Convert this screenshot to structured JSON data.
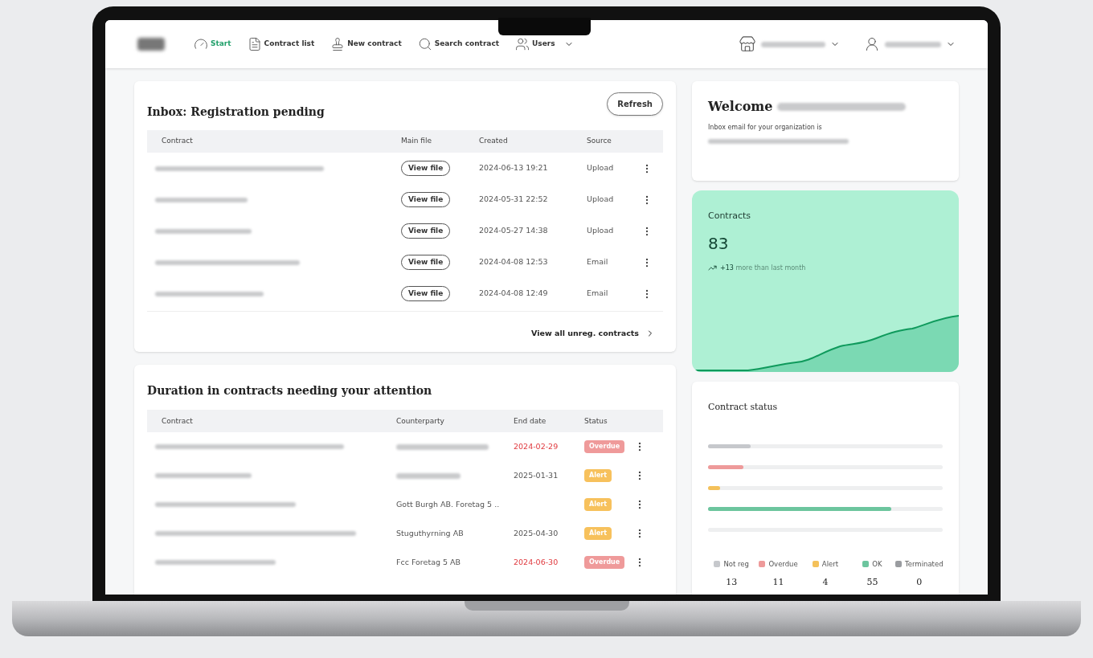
{
  "nav": {
    "items": [
      {
        "label": "Start",
        "selected": true,
        "dropdown": false
      },
      {
        "label": "Contract list",
        "selected": false,
        "dropdown": false
      },
      {
        "label": "New contract",
        "selected": false,
        "dropdown": false
      },
      {
        "label": "Search contract",
        "selected": false,
        "dropdown": false
      },
      {
        "label": "Users",
        "selected": false,
        "dropdown": true
      }
    ]
  },
  "inbox": {
    "title": "Inbox: Registration pending",
    "refresh": "Refresh",
    "columns": [
      "Contract",
      "Main file",
      "Created",
      "Source"
    ],
    "rows": [
      {
        "file": "View file",
        "created": "2024-06-13 19:21",
        "source": "Upload"
      },
      {
        "file": "View file",
        "created": "2024-05-31 22:52",
        "source": "Upload"
      },
      {
        "file": "View file",
        "created": "2024-05-27 14:38",
        "source": "Upload"
      },
      {
        "file": "View file",
        "created": "2024-04-08 12:53",
        "source": "Email"
      },
      {
        "file": "View file",
        "created": "2024-04-08 12:49",
        "source": "Email"
      }
    ],
    "footer_link": "View all unreg. contracts"
  },
  "attention": {
    "title": "Duration in contracts needing your attention",
    "columns": [
      "Contract",
      "Counterparty",
      "End date",
      "Status"
    ],
    "rows": [
      {
        "end_date": "2024-02-29",
        "status": {
          "label": "Overdue",
          "kind": "overdue"
        }
      },
      {
        "end_date": "2025-01-31",
        "status": {
          "label": "Alert",
          "kind": "alert"
        }
      },
      {
        "counterparty": "Gott Burgh AB. Foretag 5 ..",
        "status": {
          "label": "Alert",
          "kind": "alert"
        }
      },
      {
        "counterparty": "Stuguthyrning AB",
        "end_date": "2025-04-30",
        "status": {
          "label": "Alert",
          "kind": "alert"
        }
      },
      {
        "counterparty": "Fcc Foretag 5 AB",
        "end_date": "2024-06-30",
        "status": {
          "label": "Overdue",
          "kind": "overdue"
        }
      }
    ]
  },
  "welcome": {
    "title": "Welcome",
    "subtitle": "Inbox email for your organization is"
  },
  "contracts": {
    "title": "Contracts",
    "count": "83",
    "delta": "+13",
    "delta_text": "more than last month"
  },
  "status": {
    "title": "Contract status",
    "bars": [
      {
        "level": 0.18
      },
      {
        "level": 0.15
      },
      {
        "level": 0.05
      },
      {
        "level": 0.78
      }
    ],
    "legend": [
      {
        "label": "Not reg",
        "color": "#c6c8cc",
        "count": "13"
      },
      {
        "label": "Overdue",
        "color": "#ee9a9a",
        "count": "11"
      },
      {
        "label": "Alert",
        "color": "#f4c15a",
        "count": "4"
      },
      {
        "label": "OK",
        "color": "#6cc59e",
        "count": "55"
      },
      {
        "label": "Terminated",
        "color": "#9a9ca0",
        "count": "0"
      }
    ]
  }
}
